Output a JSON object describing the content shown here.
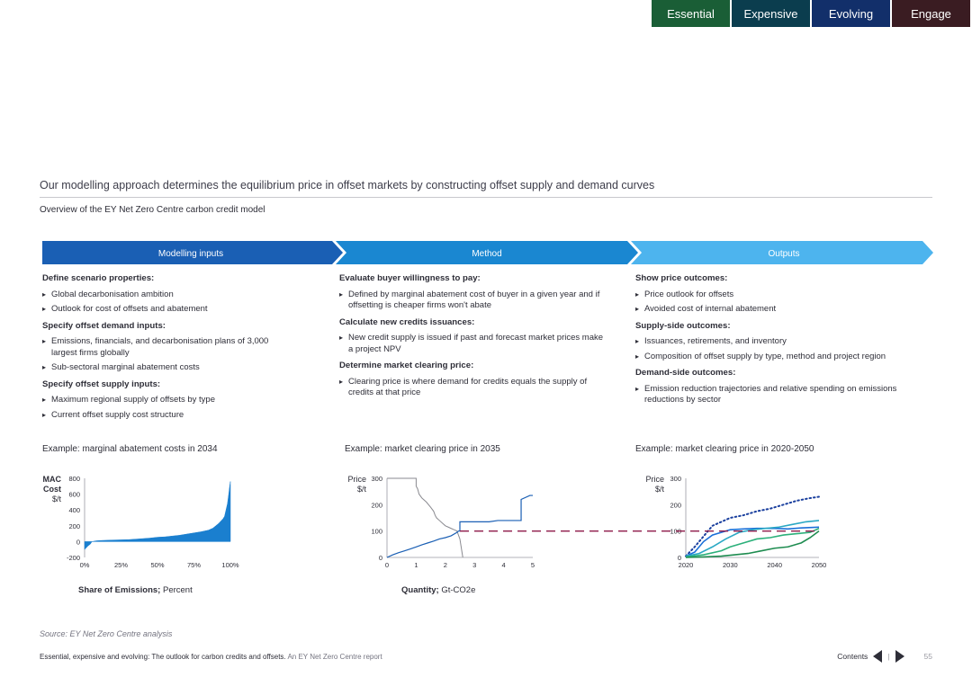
{
  "nav": {
    "tabs": [
      {
        "label": "Essential",
        "color": "#1a5e36"
      },
      {
        "label": "Expensive",
        "color": "#0b3d4e"
      },
      {
        "label": "Evolving",
        "color": "#122f6a"
      },
      {
        "label": "Engage",
        "color": "#3a1c22"
      }
    ]
  },
  "heading": "Our modelling approach determines the equilibrium price in offset markets by constructing offset supply and demand curves",
  "subheading": "Overview of the EY Net Zero Centre carbon credit model",
  "stages": [
    {
      "label": "Modelling inputs",
      "color": "#1a5fb4"
    },
    {
      "label": "Method",
      "color": "#1a87d1"
    },
    {
      "label": "Outputs",
      "color": "#4db4ee"
    }
  ],
  "columns": [
    {
      "sections": [
        {
          "title": "Define scenario properties:",
          "items": [
            "Global decarbonisation ambition",
            "Outlook for cost of offsets and abatement"
          ]
        },
        {
          "title": "Specify offset demand inputs:",
          "items": [
            "Emissions, financials, and decarbonisation plans of 3,000 largest firms globally",
            "Sub-sectoral marginal abatement costs"
          ]
        },
        {
          "title": "Specify offset supply inputs:",
          "items": [
            "Maximum regional supply of offsets by type",
            "Current offset supply cost structure"
          ]
        }
      ]
    },
    {
      "sections": [
        {
          "title": "Evaluate buyer willingness to pay:",
          "items": [
            "Defined by marginal abatement cost of buyer in a given year and if offsetting is cheaper firms won't abate"
          ]
        },
        {
          "title": "Calculate new credits issuances:",
          "items": [
            "New credit supply is issued if past and forecast market prices make a project NPV"
          ]
        },
        {
          "title": "Determine market clearing price:",
          "items": [
            "Clearing price is where demand for credits equals the supply of credits at that price"
          ]
        }
      ]
    },
    {
      "sections": [
        {
          "title": "Show price outcomes:",
          "items": [
            "Price outlook for offsets",
            "Avoided cost of internal abatement"
          ]
        },
        {
          "title": "Supply-side outcomes:",
          "items": [
            "Issuances, retirements, and inventory",
            "Composition of offset supply by type, method and project region"
          ]
        },
        {
          "title": "Demand-side outcomes:",
          "items": [
            "Emission reduction trajectories and relative spending on emissions reductions by sector"
          ]
        }
      ]
    }
  ],
  "examples": [
    {
      "title": "Example: marginal abatement costs in 2034",
      "xtitle_bold": "Share of Emissions;",
      "xtitle_rest": " Percent"
    },
    {
      "title": "Example: market clearing price in 2035",
      "xtitle_bold": "Quantity;",
      "xtitle_rest": " Gt-CO2e"
    },
    {
      "title": "Example: market clearing price in 2020-2050",
      "xtitle_bold": "",
      "xtitle_rest": ""
    }
  ],
  "chart_data": [
    {
      "type": "area",
      "ylabel": [
        "MAC",
        "Cost",
        "$/t"
      ],
      "yticks": [
        "800",
        "600",
        "400",
        "200",
        "0",
        "-200"
      ],
      "xticks": [
        "0%",
        "25%",
        "50%",
        "75%",
        "100%"
      ],
      "ylim": [
        -200,
        800
      ],
      "xlim": [
        0,
        100
      ],
      "color": "#1a7fcf",
      "x": [
        0,
        2,
        4,
        5,
        8,
        12,
        20,
        30,
        38,
        45,
        50,
        55,
        60,
        65,
        70,
        75,
        80,
        85,
        88,
        90,
        92,
        94,
        95,
        96,
        97,
        98,
        98.5,
        99,
        99.5,
        100
      ],
      "y": [
        -100,
        -60,
        -30,
        0,
        10,
        15,
        20,
        25,
        35,
        45,
        55,
        60,
        70,
        80,
        95,
        110,
        125,
        145,
        170,
        200,
        230,
        270,
        290,
        320,
        400,
        480,
        550,
        620,
        700,
        760
      ]
    },
    {
      "type": "line",
      "ylabel": [
        "Price",
        "$/t"
      ],
      "yticks": [
        "300",
        "200",
        "100",
        "0"
      ],
      "xticks": [
        "0",
        "1",
        "2",
        "3",
        "4",
        "5"
      ],
      "ylim": [
        0,
        300
      ],
      "xlim": [
        0,
        5
      ],
      "series": [
        {
          "role": "demand",
          "color": "#8a8a90",
          "x": [
            0,
            1,
            1.0,
            1.05,
            1.1,
            1.2,
            1.35,
            1.5,
            1.6,
            1.65,
            1.7,
            1.8,
            1.9,
            2.0,
            2.1,
            2.2,
            2.3,
            2.4,
            2.5,
            2.6
          ],
          "y": [
            300,
            300,
            270,
            260,
            240,
            225,
            210,
            190,
            175,
            160,
            150,
            140,
            130,
            120,
            115,
            110,
            105,
            100,
            70,
            0
          ]
        },
        {
          "role": "supply",
          "color": "#1a5fb4",
          "x": [
            0,
            0.2,
            0.4,
            0.6,
            0.8,
            1.0,
            1.2,
            1.4,
            1.6,
            1.8,
            2.0,
            2.2,
            2.4,
            2.45,
            2.5,
            2.5,
            3.0,
            3.5,
            3.8,
            4.6,
            4.6,
            4.9,
            5.0
          ],
          "y": [
            0,
            10,
            18,
            25,
            32,
            40,
            48,
            55,
            62,
            70,
            75,
            82,
            95,
            100,
            100,
            135,
            135,
            135,
            140,
            140,
            220,
            235,
            235
          ]
        }
      ],
      "clearing_price": 100
    },
    {
      "type": "line",
      "ylabel": [
        "Price",
        "$/t"
      ],
      "yticks": [
        "300",
        "200",
        "100",
        "0"
      ],
      "xticks": [
        "2020",
        "2030",
        "2040",
        "2050"
      ],
      "ylim": [
        0,
        300
      ],
      "xlim": [
        2020,
        2050
      ],
      "series": [
        {
          "color": "#1a3f9e",
          "style": "dotted",
          "x": [
            2020,
            2022,
            2024,
            2026,
            2028,
            2030,
            2033,
            2036,
            2039,
            2042,
            2045,
            2048,
            2050
          ],
          "y": [
            5,
            40,
            80,
            120,
            135,
            150,
            160,
            175,
            185,
            200,
            215,
            225,
            230
          ]
        },
        {
          "color": "#1a6fd8",
          "style": "solid",
          "x": [
            2020,
            2022,
            2024,
            2026,
            2028,
            2030,
            2033,
            2036,
            2040,
            2043,
            2046,
            2050
          ],
          "y": [
            5,
            20,
            60,
            85,
            95,
            105,
            108,
            110,
            110,
            108,
            112,
            115
          ]
        },
        {
          "color": "#2aa8c4",
          "style": "solid",
          "x": [
            2020,
            2023,
            2026,
            2029,
            2032,
            2035,
            2038,
            2041,
            2044,
            2047,
            2050
          ],
          "y": [
            5,
            15,
            40,
            70,
            95,
            105,
            110,
            115,
            125,
            135,
            140
          ]
        },
        {
          "color": "#2bb07a",
          "style": "solid",
          "x": [
            2020,
            2024,
            2028,
            2030,
            2033,
            2036,
            2039,
            2042,
            2045,
            2048,
            2050
          ],
          "y": [
            2,
            10,
            25,
            40,
            55,
            70,
            75,
            85,
            90,
            95,
            110
          ]
        },
        {
          "color": "#1e8c50",
          "style": "solid",
          "x": [
            2020,
            2024,
            2028,
            2031,
            2034,
            2037,
            2040,
            2043,
            2046,
            2048,
            2050
          ],
          "y": [
            0,
            2,
            5,
            10,
            15,
            25,
            35,
            40,
            55,
            75,
            100
          ]
        }
      ],
      "reference_line": 100,
      "reference_color": "#8e1a4a"
    }
  ],
  "source": "Source: EY Net Zero Centre analysis",
  "footer": {
    "bold": "Essential, expensive and evolving: The outlook for carbon credits and offsets.",
    "rest": " An EY Net Zero Centre report"
  },
  "pager": {
    "contents": "Contents",
    "sep": "|",
    "page": "55"
  }
}
